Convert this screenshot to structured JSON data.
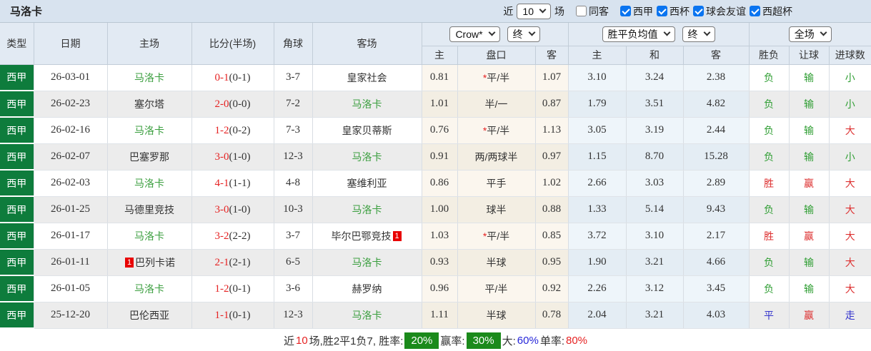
{
  "title": "马洛卡",
  "topbar": {
    "recent_label": "近",
    "recent_value": "10",
    "games_label": "场",
    "filters": [
      {
        "label": "同客",
        "checked": false
      },
      {
        "label": "西甲",
        "checked": true
      },
      {
        "label": "西杯",
        "checked": true
      },
      {
        "label": "球会友谊",
        "checked": true
      },
      {
        "label": "西超杯",
        "checked": true
      }
    ]
  },
  "controls": {
    "bookmaker": "Crow*",
    "bookmaker_state": "终",
    "avg": "胜平负均值",
    "avg_state": "终",
    "scope": "全场"
  },
  "columns": {
    "type": "类型",
    "date": "日期",
    "home": "主场",
    "score": "比分(半场)",
    "corner": "角球",
    "away": "客场",
    "odds_home": "主",
    "handicap": "盘口",
    "odds_away": "客",
    "avg_home": "主",
    "avg_draw": "和",
    "avg_away": "客",
    "res_wdl": "胜负",
    "res_handicap": "让球",
    "res_goals": "进球数"
  },
  "rows": [
    {
      "type": "西甲",
      "date": "26-03-01",
      "home": "马洛卡",
      "home_v": "self",
      "score": "0-1",
      "half": "(0-1)",
      "corner": "3-7",
      "away": "皇家社会",
      "odds_h": "0.81",
      "star": "*",
      "hcap": "平/半",
      "odds_a": "1.07",
      "avg_h": "3.10",
      "avg_d": "3.24",
      "avg_a": "2.38",
      "r_wdl": "负",
      "r_wdl_v": "g",
      "r_let": "输",
      "r_let_v": "g",
      "r_goal": "小",
      "r_goal_v": "g"
    },
    {
      "type": "西甲",
      "date": "26-02-23",
      "home": "塞尔塔",
      "score": "2-0",
      "half": "(0-0)",
      "corner": "7-2",
      "away": "马洛卡",
      "away_v": "self",
      "odds_h": "1.01",
      "hcap": "半/一",
      "odds_a": "0.87",
      "avg_h": "1.79",
      "avg_d": "3.51",
      "avg_a": "4.82",
      "r_wdl": "负",
      "r_wdl_v": "g",
      "r_let": "输",
      "r_let_v": "g",
      "r_goal": "小",
      "r_goal_v": "g"
    },
    {
      "type": "西甲",
      "date": "26-02-16",
      "home": "马洛卡",
      "home_v": "self",
      "score": "1-2",
      "half": "(0-2)",
      "corner": "7-3",
      "away": "皇家贝蒂斯",
      "odds_h": "0.76",
      "star": "*",
      "hcap": "平/半",
      "odds_a": "1.13",
      "avg_h": "3.05",
      "avg_d": "3.19",
      "avg_a": "2.44",
      "r_wdl": "负",
      "r_wdl_v": "g",
      "r_let": "输",
      "r_let_v": "g",
      "r_goal": "大",
      "r_goal_v": "r"
    },
    {
      "type": "西甲",
      "date": "26-02-07",
      "home": "巴塞罗那",
      "score": "3-0",
      "half": "(1-0)",
      "corner": "12-3",
      "away": "马洛卡",
      "away_v": "self",
      "odds_h": "0.91",
      "hcap": "两/两球半",
      "odds_a": "0.97",
      "avg_h": "1.15",
      "avg_d": "8.70",
      "avg_a": "15.28",
      "r_wdl": "负",
      "r_wdl_v": "g",
      "r_let": "输",
      "r_let_v": "g",
      "r_goal": "小",
      "r_goal_v": "g"
    },
    {
      "type": "西甲",
      "date": "26-02-03",
      "home": "马洛卡",
      "home_v": "self",
      "score": "4-1",
      "half": "(1-1)",
      "corner": "4-8",
      "away": "塞维利亚",
      "odds_h": "0.86",
      "hcap": "平手",
      "odds_a": "1.02",
      "avg_h": "2.66",
      "avg_d": "3.03",
      "avg_a": "2.89",
      "r_wdl": "胜",
      "r_wdl_v": "r",
      "r_let": "赢",
      "r_let_v": "r",
      "r_goal": "大",
      "r_goal_v": "r"
    },
    {
      "type": "西甲",
      "date": "26-01-25",
      "home": "马德里竞技",
      "score": "3-0",
      "half": "(1-0)",
      "corner": "10-3",
      "away": "马洛卡",
      "away_v": "self",
      "odds_h": "1.00",
      "hcap": "球半",
      "odds_a": "0.88",
      "avg_h": "1.33",
      "avg_d": "5.14",
      "avg_a": "9.43",
      "r_wdl": "负",
      "r_wdl_v": "g",
      "r_let": "输",
      "r_let_v": "g",
      "r_goal": "大",
      "r_goal_v": "r"
    },
    {
      "type": "西甲",
      "date": "26-01-17",
      "home": "马洛卡",
      "home_v": "self",
      "score": "3-2",
      "half": "(2-2)",
      "corner": "3-7",
      "away": "毕尔巴鄂竞技",
      "away_badge": "1",
      "odds_h": "1.03",
      "star": "*",
      "hcap": "平/半",
      "odds_a": "0.85",
      "avg_h": "3.72",
      "avg_d": "3.10",
      "avg_a": "2.17",
      "r_wdl": "胜",
      "r_wdl_v": "r",
      "r_let": "赢",
      "r_let_v": "r",
      "r_goal": "大",
      "r_goal_v": "r"
    },
    {
      "type": "西甲",
      "date": "26-01-11",
      "home": "巴列卡诺",
      "home_badge": "1",
      "score": "2-1",
      "half": "(2-1)",
      "corner": "6-5",
      "away": "马洛卡",
      "away_v": "self",
      "odds_h": "0.93",
      "hcap": "半球",
      "odds_a": "0.95",
      "avg_h": "1.90",
      "avg_d": "3.21",
      "avg_a": "4.66",
      "r_wdl": "负",
      "r_wdl_v": "g",
      "r_let": "输",
      "r_let_v": "g",
      "r_goal": "大",
      "r_goal_v": "r"
    },
    {
      "type": "西甲",
      "date": "26-01-05",
      "home": "马洛卡",
      "home_v": "self",
      "score": "1-2",
      "half": "(0-1)",
      "corner": "3-6",
      "away": "赫罗纳",
      "odds_h": "0.96",
      "hcap": "平/半",
      "odds_a": "0.92",
      "avg_h": "2.26",
      "avg_d": "3.12",
      "avg_a": "3.45",
      "r_wdl": "负",
      "r_wdl_v": "g",
      "r_let": "输",
      "r_let_v": "g",
      "r_goal": "大",
      "r_goal_v": "r"
    },
    {
      "type": "西甲",
      "date": "25-12-20",
      "home": "巴伦西亚",
      "score": "1-1",
      "half": "(0-1)",
      "corner": "12-3",
      "away": "马洛卡",
      "away_v": "self",
      "odds_h": "1.11",
      "hcap": "半球",
      "odds_a": "0.78",
      "avg_h": "2.04",
      "avg_d": "3.21",
      "avg_a": "4.03",
      "r_wdl": "平",
      "r_wdl_v": "b",
      "r_let": "赢",
      "r_let_v": "r",
      "r_goal": "走",
      "r_goal_v": "b"
    }
  ],
  "summary": {
    "prefix": "近",
    "count": "10",
    "record": "场,胜2平1负7, 胜率:",
    "win_rate": "20%",
    "handicap_label": "赢率:",
    "handicap_rate": "30%",
    "big_label": "大:",
    "big_rate": "60%",
    "single_label": "单率:",
    "single_rate": "80%"
  },
  "colors": {
    "league_cell_green": "#0e7c3c",
    "team_green": "#3a9e3e",
    "result_green": "#2f9e33",
    "result_red": "#dd3030",
    "result_blue": "#3333cc",
    "score_red": "#e62222",
    "rate_badge_green": "#1b8a1b",
    "checkbox_blue": "#0a74f0"
  }
}
